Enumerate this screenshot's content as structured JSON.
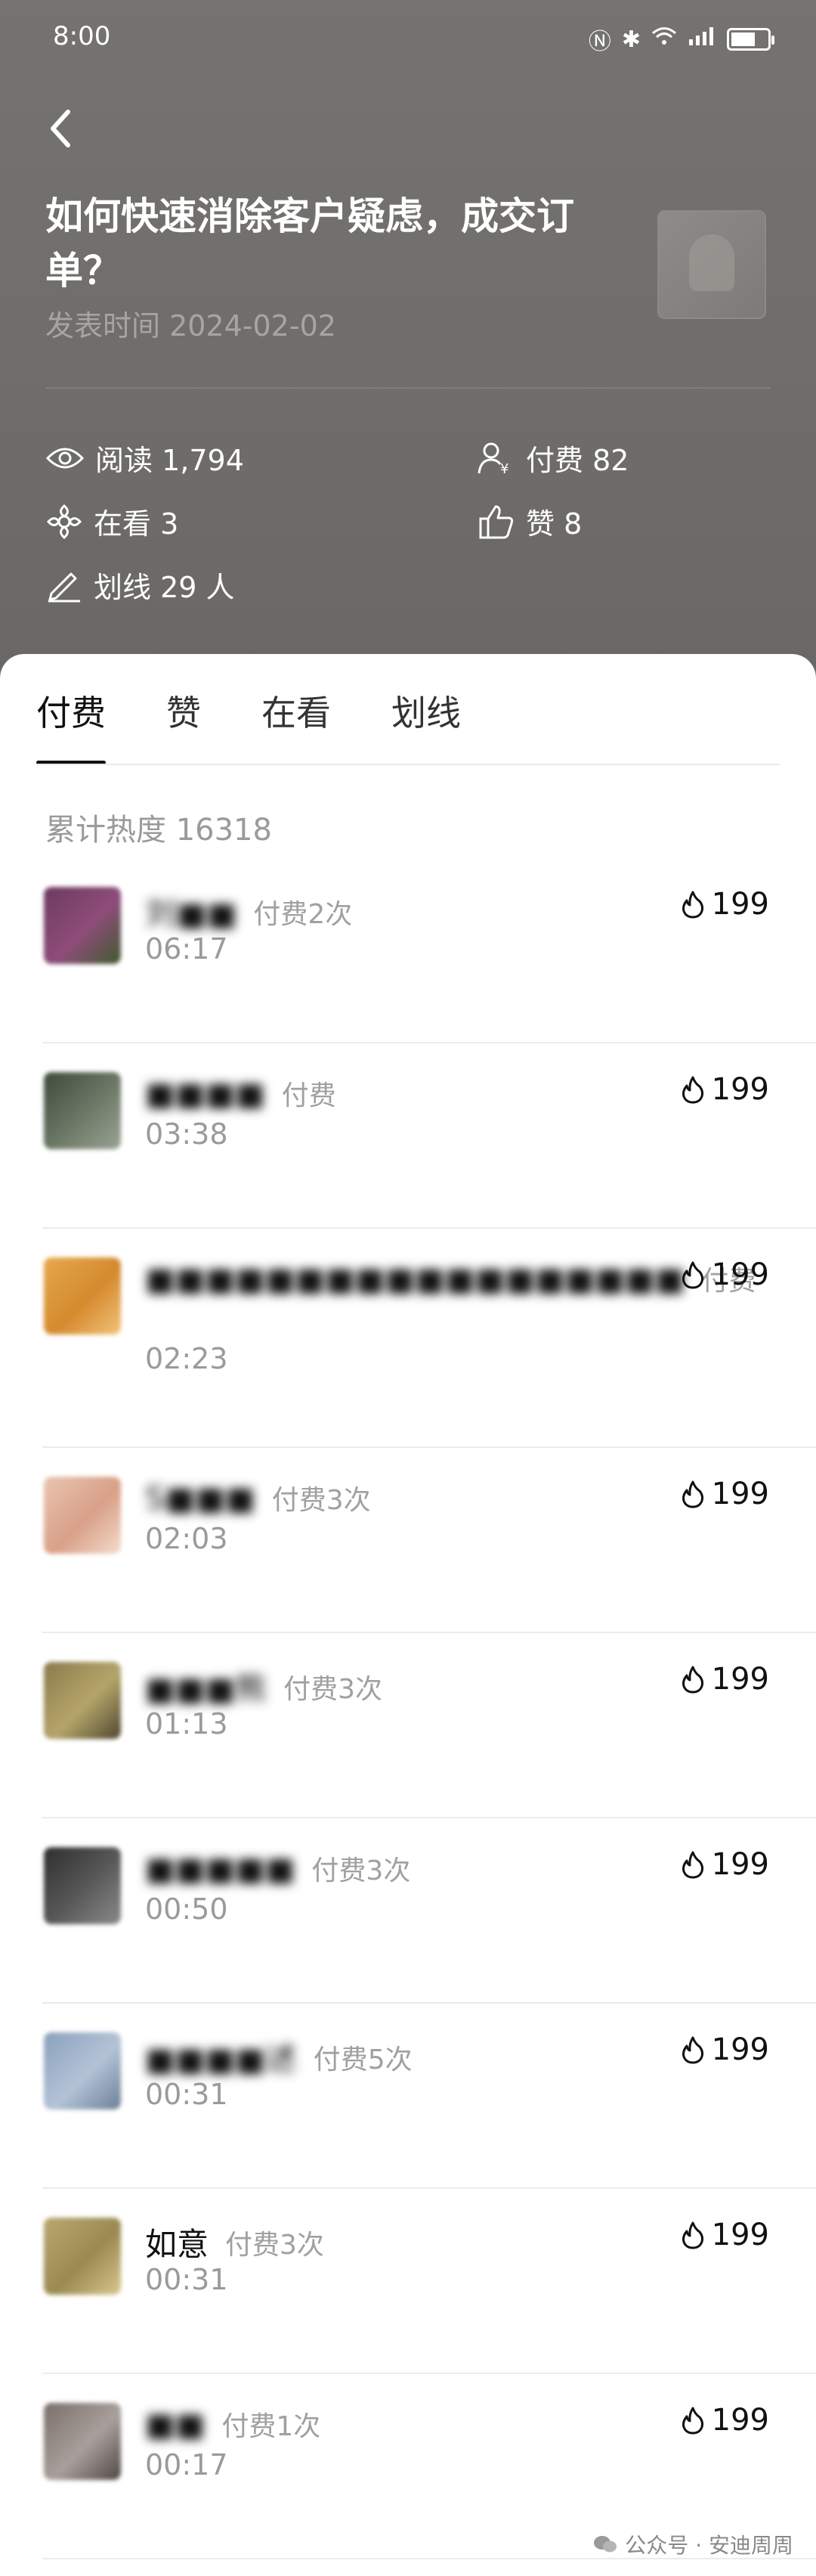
{
  "status": {
    "time": "8:00"
  },
  "article": {
    "title": "如何快速消除客户疑虑，成交订单？",
    "publish_time": "发表时间 2024-02-02"
  },
  "stats": {
    "read": "阅读 1,794",
    "paid": "付费 82",
    "watching": "在看 3",
    "likes": "赞 8",
    "underline": "划线 29 人"
  },
  "tabs": [
    "付费",
    "赞",
    "在看",
    "划线"
  ],
  "heat": "累计热度 16318",
  "rows": [
    {
      "name": "刘■■",
      "count": "付费2次",
      "time": "06:17",
      "amount": "199",
      "avatar": [
        "#6b3b5e",
        "#8e4c7a",
        "#3f5b2e"
      ]
    },
    {
      "name": "■■■■",
      "count": "付费",
      "time": "03:38",
      "amount": "199",
      "avatar": [
        "#3d4a3a",
        "#6e7a68",
        "#9aa394"
      ]
    },
    {
      "name": "■■■■■■■■■■■■■■■■■■",
      "count": "付费",
      "time": "02:23",
      "amount": "199",
      "avatar": [
        "#e6a84e",
        "#d48a2e",
        "#f2c27a"
      ]
    },
    {
      "name": "S■■■",
      "count": "付费3次",
      "time": "02:03",
      "amount": "199",
      "avatar": [
        "#e9c4b0",
        "#d9a088",
        "#f4dccd"
      ]
    },
    {
      "name": "■■■熊",
      "count": "付费3次",
      "time": "01:13",
      "amount": "199",
      "avatar": [
        "#8a7a4e",
        "#b5a56a",
        "#4e4630"
      ]
    },
    {
      "name": "■■■■■",
      "count": "付费3次",
      "time": "00:50",
      "amount": "199",
      "avatar": [
        "#2e2e2e",
        "#5a5a5a",
        "#8a8a8a"
      ]
    },
    {
      "name": "■■■■述",
      "count": "付费5次",
      "time": "00:31",
      "amount": "199",
      "avatar": [
        "#8aa0bd",
        "#b4c3d6",
        "#6a7f99"
      ]
    },
    {
      "name": "如意",
      "count": "付费3次",
      "time": "00:31",
      "amount": "199",
      "avatar": [
        "#b8a66e",
        "#9a8a52",
        "#d8c890"
      ],
      "clear": true
    },
    {
      "name": "■■",
      "count": "付费1次",
      "time": "00:17",
      "amount": "199",
      "avatar": [
        "#7a6e6a",
        "#a8a09c",
        "#4e4644"
      ]
    }
  ],
  "watermark": "公众号 · 安迪周周"
}
